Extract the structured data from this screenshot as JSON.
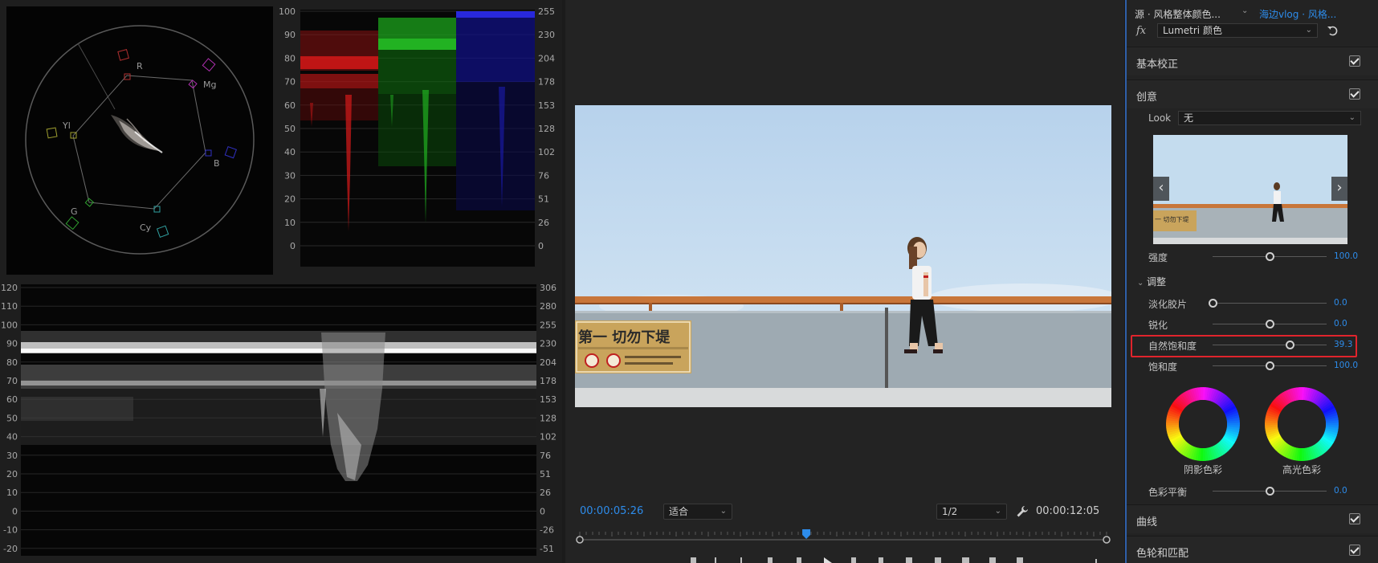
{
  "scopes": {
    "vectorscope": {
      "targets": [
        "R",
        "Mg",
        "B",
        "Cy",
        "G",
        "Yl"
      ]
    },
    "rgb_parade": {
      "left_scale": [
        "100",
        "90",
        "80",
        "70",
        "60",
        "50",
        "40",
        "30",
        "20",
        "10",
        "0"
      ],
      "right_scale": [
        "255",
        "230",
        "204",
        "178",
        "153",
        "128",
        "102",
        "76",
        "51",
        "26",
        "0"
      ]
    },
    "waveform": {
      "left_scale": [
        "120",
        "110",
        "100",
        "90",
        "80",
        "70",
        "60",
        "50",
        "40",
        "30",
        "20",
        "10",
        "0",
        "-10",
        "-20"
      ],
      "right_scale": [
        "306",
        "280",
        "255",
        "230",
        "204",
        "178",
        "153",
        "128",
        "102",
        "76",
        "51",
        "26",
        "0",
        "-26",
        "-51"
      ]
    }
  },
  "monitor": {
    "current_timecode": "00:00:05:26",
    "duration_timecode": "00:00:12:05",
    "fit_select": "适合",
    "resolution_select": "1/2",
    "frame": {
      "sign_main_text": "第一 切勿下堤"
    },
    "playhead_fraction": 0.43
  },
  "lumetri": {
    "source_label": "源 · 风格整体颜色...",
    "sequence_label": "海边vlog · 风格...",
    "fx_label": "fx",
    "effect_name": "Lumetri 颜色",
    "sections": {
      "basic": "基本校正",
      "creative": "创意",
      "curves": "曲线",
      "wheels_match": "色轮和匹配"
    },
    "look_label": "Look",
    "look_value": "无",
    "intensity": {
      "label": "强度",
      "value": "100.0",
      "fraction": 0.5
    },
    "adjust_label": "调整",
    "faded_film": {
      "label": "淡化胶片",
      "value": "0.0",
      "fraction": 0.0
    },
    "sharpen": {
      "label": "锐化",
      "value": "0.0",
      "fraction": 0.5
    },
    "vibrance": {
      "label": "自然饱和度",
      "value": "39.3",
      "fraction": 0.68
    },
    "saturation": {
      "label": "饱和度",
      "value": "100.0",
      "fraction": 0.5
    },
    "shadow_tint": "阴影色彩",
    "highlight_tint": "高光色彩",
    "tint_balance": {
      "label": "色彩平衡",
      "value": "0.0",
      "fraction": 0.5
    }
  },
  "colors": {
    "accent_blue": "#2d8ceb",
    "highlight_red": "#e0242c"
  }
}
